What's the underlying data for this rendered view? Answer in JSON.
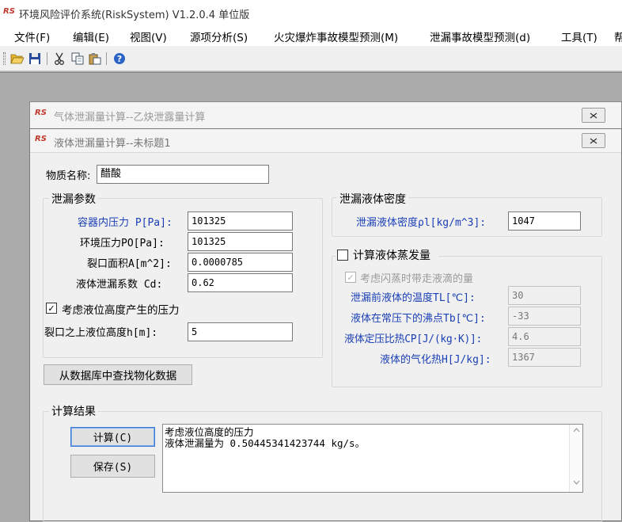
{
  "app": {
    "title": "环境风险评价系统(RiskSystem) V1.2.0.4 单位版",
    "logo": "RS"
  },
  "menu": [
    "文件(F)",
    "编辑(E)",
    "视图(V)",
    "源项分析(S)",
    "火灾爆炸事故模型预测(M)",
    "泄漏事故模型预测(d)",
    "工具(T)",
    "帮"
  ],
  "back_window": {
    "title": "气体泄漏量计算--乙炔泄露量计算"
  },
  "front_window": {
    "title": "液体泄漏量计算--未标题1",
    "substance": {
      "label": "物质名称:",
      "value": "醋酸"
    },
    "leak_params": {
      "title": "泄漏参数",
      "pressure_label": "容器内压力 P[Pa]:",
      "pressure_value": "101325",
      "ambient_label": "环境压力PO[Pa]:",
      "ambient_value": "101325",
      "area_label": "裂口面积A[m^2]:",
      "area_value": "0.0000785",
      "cd_label": "液体泄漏系数  Cd:",
      "cd_value": "0.62",
      "height_check_label": "考虑液位高度产生的压力",
      "height_check_checked": true,
      "height_label": "裂口之上液位高度h[m]:",
      "height_value": "5"
    },
    "density": {
      "title": "泄漏液体密度",
      "label": "泄漏液体密度ρl[kg/m^3]:",
      "value": "1047"
    },
    "evaporation": {
      "title": "计算液体蒸发量",
      "checked": false,
      "flash_label": "考虑闪蒸时带走液滴的量",
      "flash_checked": true,
      "temp_label": "泄漏前液体的温度TL[℃]:",
      "temp_value": "30",
      "boil_label": "液体在常压下的沸点Tb[℃]:",
      "boil_value": "-33",
      "cp_label": "液体定压比热CP[J/(kg·K)]:",
      "cp_value": "4.6",
      "heat_label": "液体的气化热H[J/kg]:",
      "heat_value": "1367"
    },
    "db_button": "从数据库中查找物化数据",
    "results": {
      "title": "计算结果",
      "calc_button": "计算(C)",
      "save_button": "保存(S)",
      "line1": "考虑液位高度的压力",
      "line2": "液体泄漏量为 0.50445341423744 kg/s。"
    }
  }
}
